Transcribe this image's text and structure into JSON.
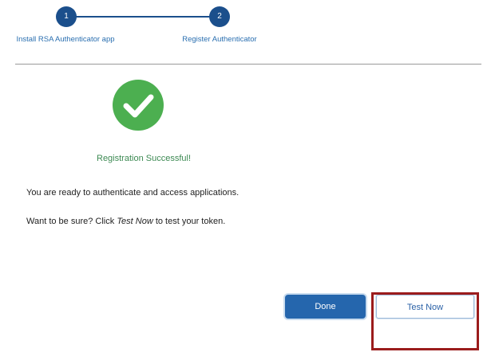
{
  "stepper": {
    "steps": [
      {
        "number": "1",
        "label": "Install RSA Authenticator app"
      },
      {
        "number": "2",
        "label": "Register Authenticator"
      }
    ]
  },
  "success": {
    "icon": "checkmark-circle-icon",
    "title": "Registration Successful!",
    "message_ready": "You are ready to authenticate and access applications.",
    "message_test_prefix": "Want to be sure? Click ",
    "message_test_emphasis": "Test Now",
    "message_test_suffix": " to test your token."
  },
  "actions": {
    "done_label": "Done",
    "test_now_label": "Test Now"
  },
  "colors": {
    "step_blue": "#1b4f8c",
    "link_blue": "#2a6fb0",
    "success_green": "#4caf50",
    "highlight_red": "#9b1c1c"
  }
}
